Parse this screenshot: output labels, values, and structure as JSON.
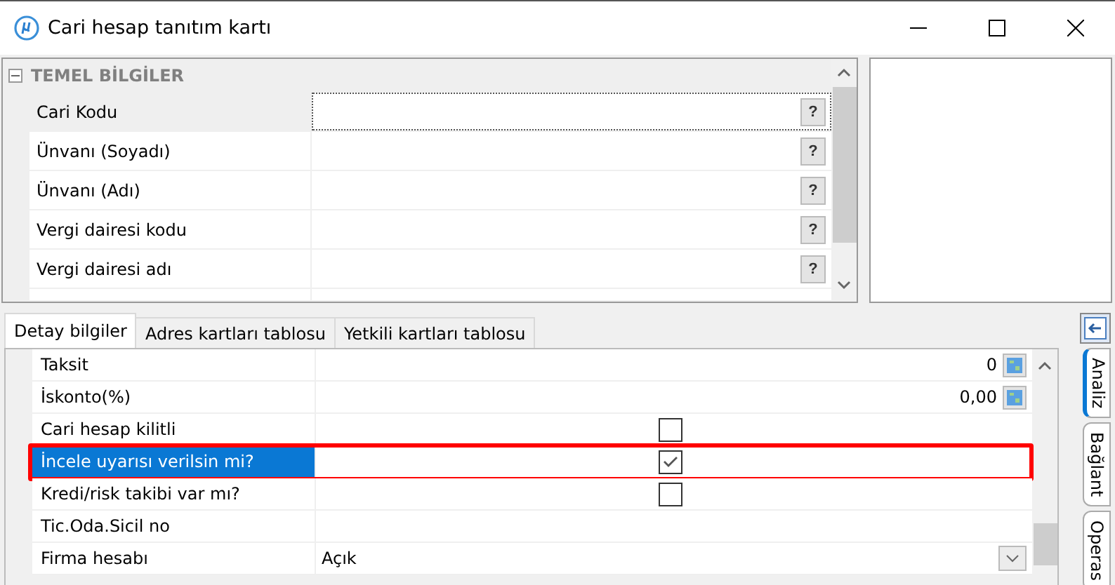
{
  "window": {
    "title": "Cari hesap tanıtım kartı"
  },
  "top_grid": {
    "section": {
      "title": "TEMEL BİLGİLER",
      "expanded": true
    },
    "rows": [
      {
        "label": "Cari Kodu",
        "focused": true
      },
      {
        "label": "Ünvanı (Soyadı)",
        "focused": false
      },
      {
        "label": "Ünvanı (Adı)",
        "focused": false
      },
      {
        "label": "Vergi dairesi kodu",
        "focused": false
      },
      {
        "label": "Vergi dairesi adı",
        "focused": false
      }
    ],
    "help_label": "?"
  },
  "tabs": [
    {
      "label": "Detay bilgiler",
      "selected": true
    },
    {
      "label": "Adres kartları tablosu",
      "selected": false
    },
    {
      "label": "Yetkili kartları tablosu",
      "selected": false
    }
  ],
  "detail_rows": [
    {
      "kind": "number",
      "label": "Taksit",
      "value": "0",
      "selected": false,
      "highlighted": false
    },
    {
      "kind": "number",
      "label": "İskonto(%)",
      "value": "0,00",
      "selected": false,
      "highlighted": false
    },
    {
      "kind": "checkbox",
      "label": "Cari hesap kilitli",
      "checked": false,
      "selected": false,
      "highlighted": false
    },
    {
      "kind": "checkbox",
      "label": "İncele uyarısı verilsin mi?",
      "checked": true,
      "selected": true,
      "highlighted": true
    },
    {
      "kind": "checkbox",
      "label": "Kredi/risk takibi var mı?",
      "checked": false,
      "selected": false,
      "highlighted": false
    },
    {
      "kind": "text",
      "label": "Tic.Oda.Sicil no",
      "selected": false,
      "highlighted": false
    },
    {
      "kind": "dropdown",
      "label": "Firma hesabı",
      "value": "Açık",
      "selected": false,
      "highlighted": false
    }
  ],
  "side_tabs": [
    {
      "label": "Analiz",
      "selected": true
    },
    {
      "label": "Bağlant",
      "selected": false
    },
    {
      "label": "Operas",
      "selected": false
    }
  ]
}
